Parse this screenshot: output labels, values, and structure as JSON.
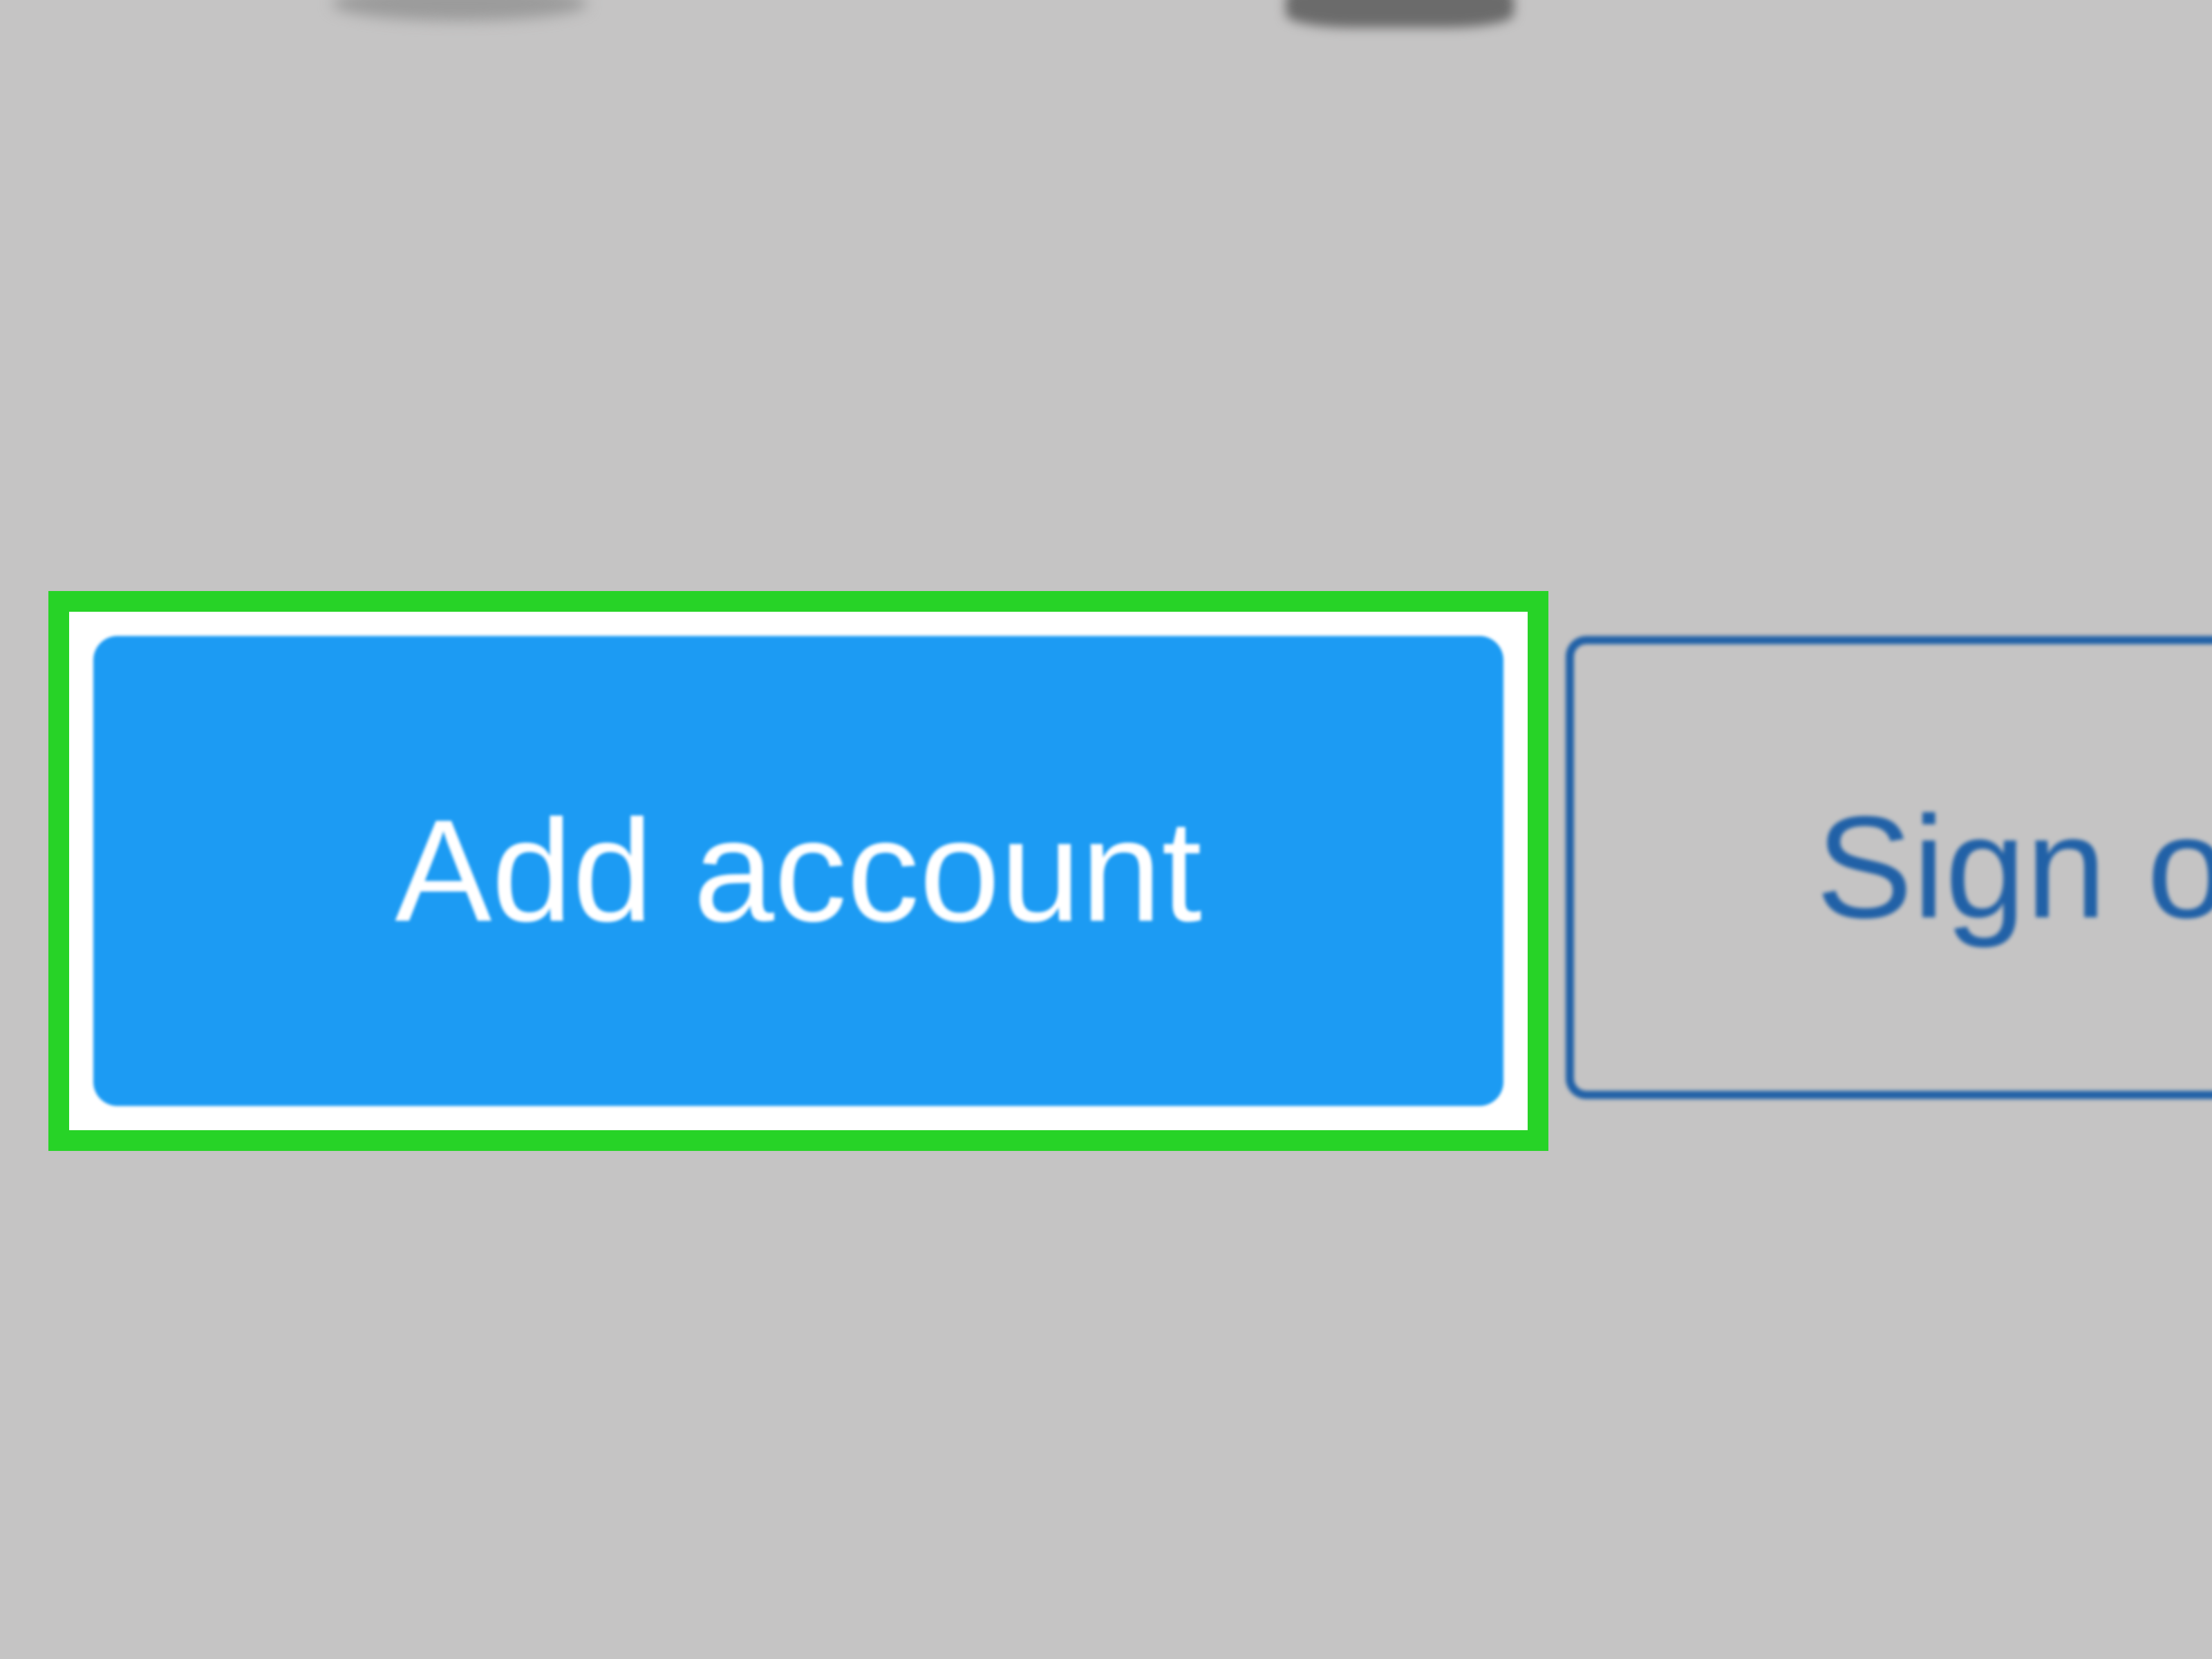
{
  "buttons": {
    "add_account_label": "Add account",
    "sign_label": "Sign o"
  },
  "colors": {
    "highlight_border": "#27D327",
    "primary_button_bg": "#1C9BF3",
    "secondary_button_border": "#2161A7",
    "background": "#C5C4C4"
  }
}
